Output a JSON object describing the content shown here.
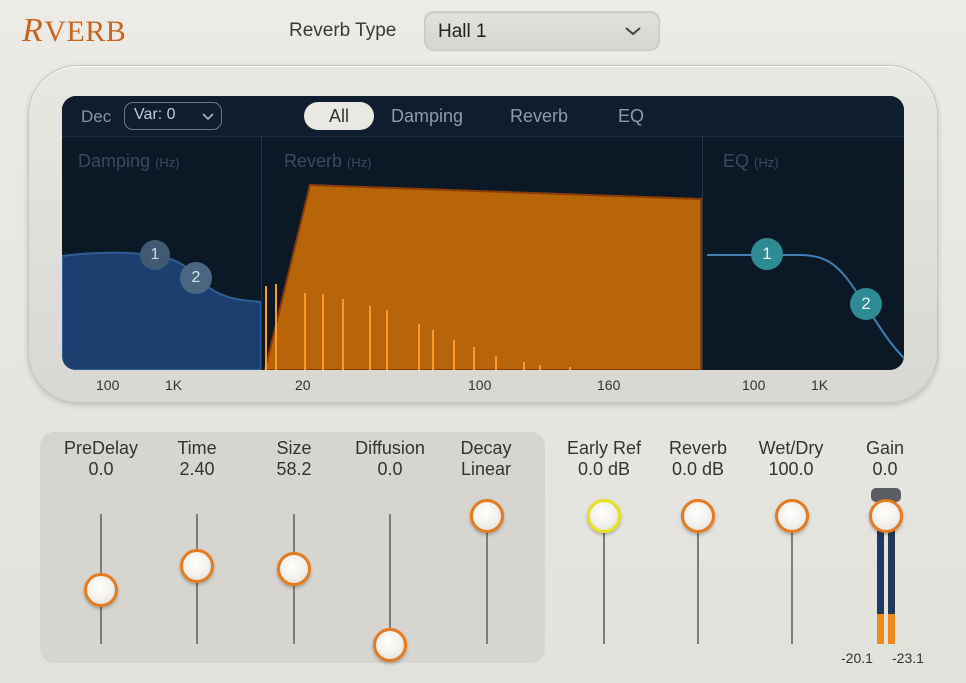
{
  "header": {
    "logo_initial": "R",
    "logo_rest": "VERB",
    "reverb_type_label": "Reverb Type",
    "reverb_type_value": "Hall 1"
  },
  "display": {
    "dec_label": "Dec",
    "dec_value": "Var: 0",
    "tabs": [
      "All",
      "Damping",
      "Reverb",
      "EQ"
    ],
    "active_tab": "All",
    "sections": {
      "damping": {
        "title": "Damping",
        "unit": "(Hz)"
      },
      "reverb": {
        "title": "Reverb",
        "unit": "(Hz)"
      },
      "eq": {
        "title": "EQ",
        "unit": "(Hz)"
      }
    },
    "nodes": {
      "damping_1": "1",
      "damping_2": "2",
      "eq_1": "1",
      "eq_2": "2"
    },
    "axis": {
      "damping": [
        "100",
        "1K"
      ],
      "reverb": [
        "20",
        "100",
        "160"
      ],
      "eq": [
        "100",
        "1K"
      ]
    }
  },
  "controls": {
    "predelay": {
      "name": "PreDelay",
      "value": "0.0",
      "level": 0.43
    },
    "time": {
      "name": "Time",
      "value": "2.40",
      "level": 0.61
    },
    "size": {
      "name": "Size",
      "value": "58.2",
      "level": 0.59
    },
    "diffusion": {
      "name": "Diffusion",
      "value": "0.0",
      "level": 0.0
    },
    "decay": {
      "name": "Decay",
      "value": "Linear",
      "level": 1.0
    },
    "early_ref": {
      "name": "Early Ref",
      "value": "0.0 dB",
      "level": 1.0
    },
    "reverb": {
      "name": "Reverb",
      "value": "0.0 dB",
      "level": 1.0
    },
    "wet_dry": {
      "name": "Wet/Dry",
      "value": "100.0",
      "level": 1.0
    },
    "gain": {
      "name": "Gain",
      "value": "0.0",
      "level": 1.0
    }
  },
  "meters": {
    "left_label": "-20.1",
    "right_label": "-23.1",
    "left_level": 0.26,
    "right_level": 0.26
  },
  "colors": {
    "accent": "#e57a1e",
    "selected_knob": "#e8e21a",
    "reverb_fill": "#b8650a",
    "damping_fill": "#1d3f70",
    "eq_curve": "#3f7fb3",
    "eq_node": "#2e8a93",
    "screen_bg": "#0b1826"
  }
}
